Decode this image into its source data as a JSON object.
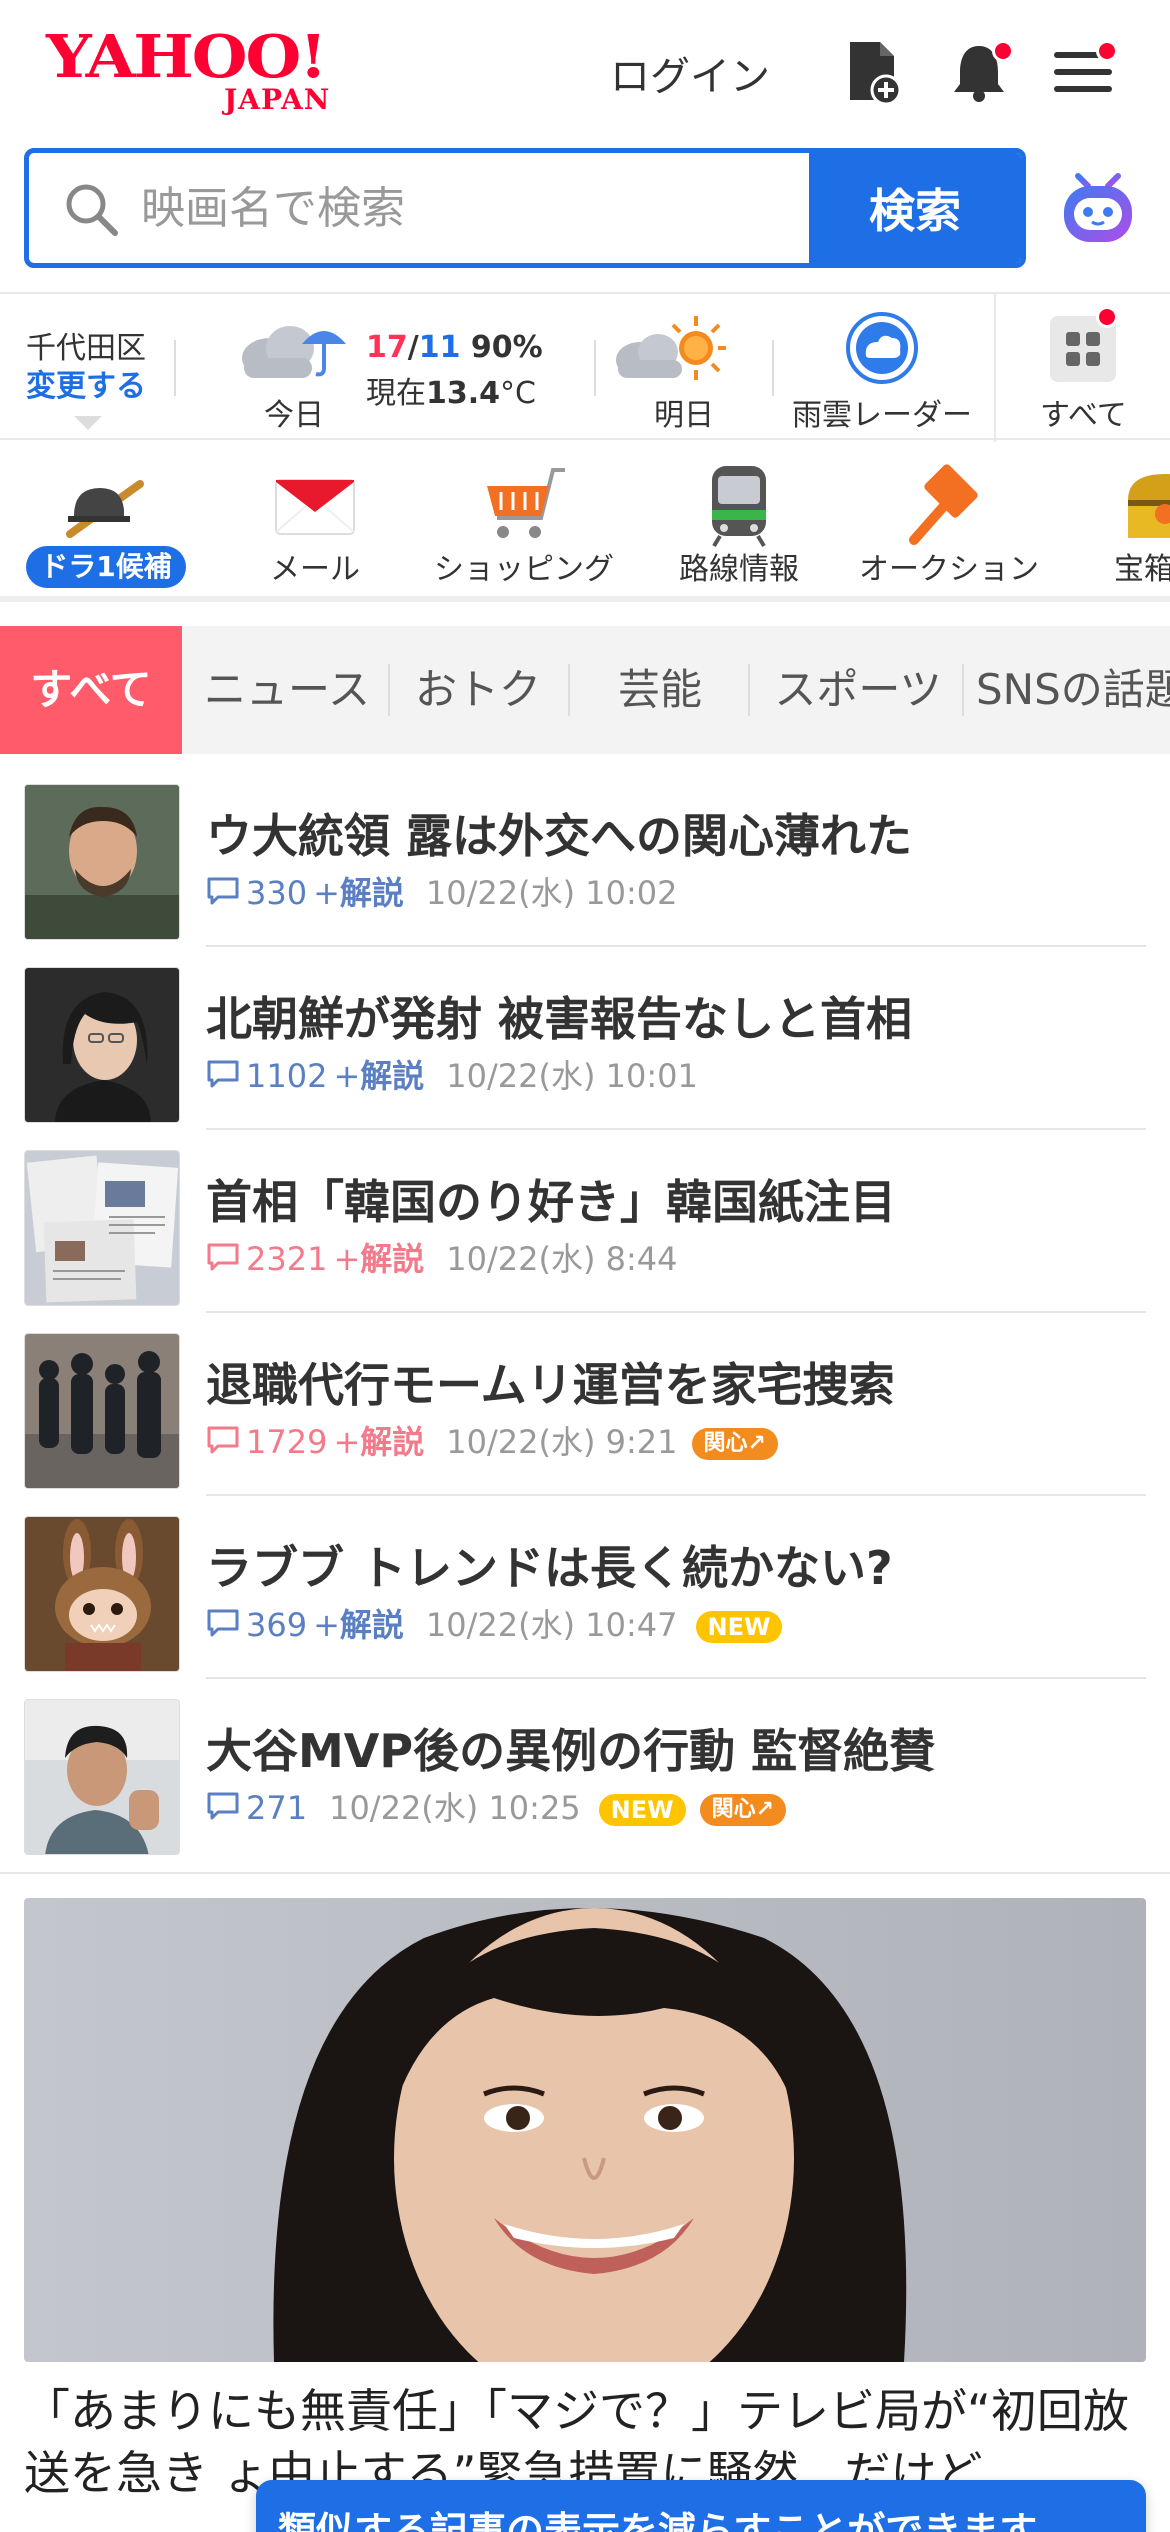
{
  "header": {
    "logo_text": "YAHOO!",
    "logo_sub": "JAPAN",
    "login_label": "ログイン"
  },
  "search": {
    "placeholder": "映画名で検索",
    "button_label": "検索"
  },
  "weather": {
    "location": "千代田区",
    "change_label": "変更する",
    "today_label": "今日",
    "high": "17",
    "slash": "/",
    "low": "11",
    "precip": "90%",
    "now_prefix": "現在",
    "now_temp": "13.4",
    "now_unit": "°C",
    "tomorrow_label": "明日",
    "radar_label": "雨雲レーダー",
    "all_label": "すべて"
  },
  "services": {
    "draft_label": "ドラ1候補",
    "mail": "メール",
    "shopping": "ショッピング",
    "transit": "路線情報",
    "auction": "オークション",
    "takarabako": "宝箱"
  },
  "tabs": [
    "すべて",
    "ニュース",
    "おトク",
    "芸能",
    "スポーツ",
    "SNSの話題"
  ],
  "news": [
    {
      "title": "ウ大統領 露は外交への関心薄れた",
      "comments": "330",
      "plus": "+",
      "explain": "解説",
      "time": "10/22(水) 10:02",
      "hot": false,
      "badges": []
    },
    {
      "title": "北朝鮮が発射 被害報告なしと首相",
      "comments": "1102",
      "plus": "+",
      "explain": "解説",
      "time": "10/22(水) 10:01",
      "hot": false,
      "badges": []
    },
    {
      "title": "首相「韓国のり好き」韓国紙注目",
      "comments": "2321",
      "plus": "+",
      "explain": "解説",
      "time": "10/22(水) 8:44",
      "hot": true,
      "badges": []
    },
    {
      "title": "退職代行モームリ運営を家宅捜索",
      "comments": "1729",
      "plus": "+",
      "explain": "解説",
      "time": "10/22(水) 9:21",
      "hot": true,
      "badges": [
        "関心↗"
      ]
    },
    {
      "title": "ラブブ トレンドは長く続かない?",
      "comments": "369",
      "plus": "+",
      "explain": "解説",
      "time": "10/22(水) 10:47",
      "hot": false,
      "badges": [
        "NEW"
      ]
    },
    {
      "title": "大谷MVP後の異例の行動 監督絶賛",
      "comments": "271",
      "plus": "",
      "explain": "",
      "time": "10/22(水) 10:25",
      "hot": false,
      "badges": [
        "NEW",
        "関心↗"
      ]
    }
  ],
  "feature": {
    "text": "「あまりにも無責任」「マジで？」テレビ局が“初回放送を急き ょ中止する”緊急措置に騒然…だけど…"
  },
  "toast": {
    "text": "類似する記事の表示を減らすことができます"
  },
  "colors": {
    "brand_red": "#ff0033",
    "accent_blue": "#1e6ee6",
    "tab_active": "#ff5b6b",
    "hot_pink": "#f27a8a",
    "badge_new": "#ffc400",
    "badge_interest": "#f28c1e"
  }
}
